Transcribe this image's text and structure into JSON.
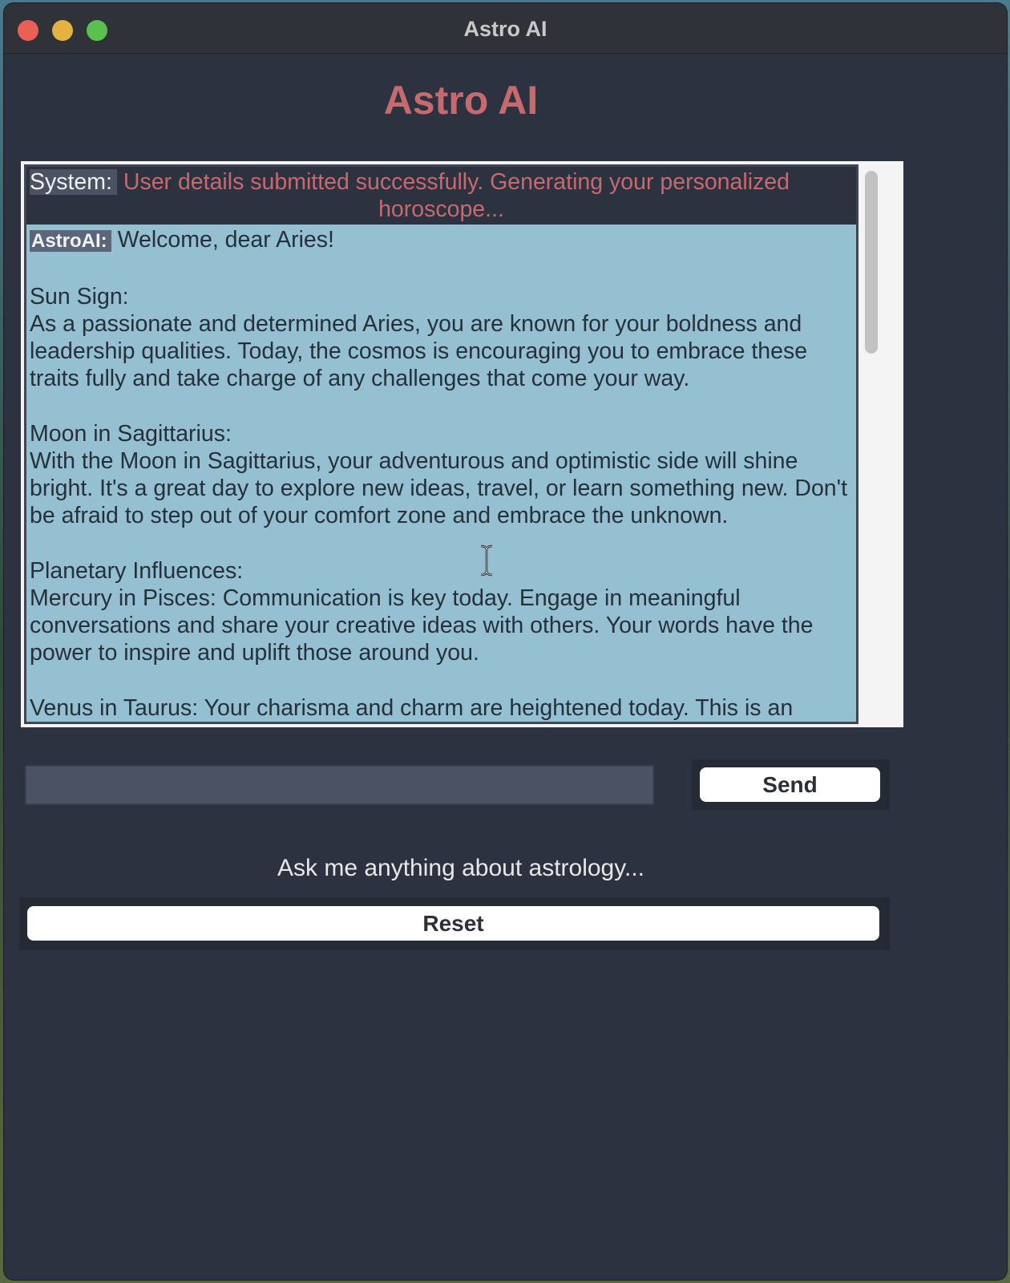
{
  "window": {
    "title": "Astro AI"
  },
  "app": {
    "heading": "Astro AI"
  },
  "chat": {
    "system_label": "System:",
    "system_message_line1": "User details submitted successfully. Generating your personalized",
    "system_message_line2": "horoscope...",
    "ai_label": "AstroAI:",
    "ai_message": " Welcome, dear Aries!\n\nSun Sign:\nAs a passionate and determined Aries, you are known for your boldness and leadership qualities. Today, the cosmos is encouraging you to embrace these traits fully and take charge of any challenges that come your way.\n\nMoon in Sagittarius:\nWith the Moon in Sagittarius, your adventurous and optimistic side will shine bright. It's a great day to explore new ideas, travel, or learn something new. Don't be afraid to step out of your comfort zone and embrace the unknown.\n\nPlanetary Influences:\nMercury in Pisces: Communication is key today. Engage in meaningful conversations and share your creative ideas with others. Your words have the power to inspire and uplift those around you.\n\nVenus in Taurus: Your charisma and charm are heightened today. This is an"
  },
  "input": {
    "value": "",
    "placeholder": ""
  },
  "buttons": {
    "send_label": "Send",
    "reset_label": "Reset"
  },
  "hint": "Ask me anything about astrology...",
  "colors": {
    "window_bg": "#2d3240",
    "accent": "#c66a6e",
    "chat_bg": "#95c0d2",
    "input_bg": "#4a5263"
  }
}
